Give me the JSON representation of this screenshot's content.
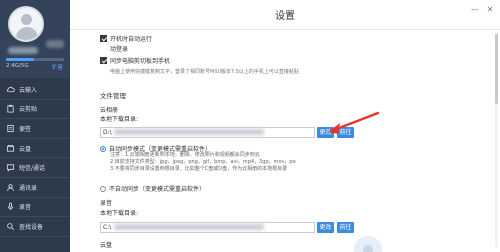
{
  "sidebar": {
    "storage_text": "2.4G/5G",
    "storage_link": "扩容",
    "storage_fraction": 0.48,
    "items": [
      {
        "label": "云输入",
        "icon": "cloud-input-icon"
      },
      {
        "label": "云剪贴",
        "icon": "clipboard-icon"
      },
      {
        "label": "便签",
        "icon": "note-icon"
      },
      {
        "label": "云盘",
        "icon": "cloud-drive-icon"
      },
      {
        "label": "短信/通话",
        "icon": "message-icon"
      },
      {
        "label": "通讯录",
        "icon": "contacts-icon"
      },
      {
        "label": "录音",
        "icon": "microphone-icon"
      },
      {
        "label": "查找设备",
        "icon": "find-device-icon"
      }
    ]
  },
  "header": {
    "title": "设置",
    "minimize": "—",
    "close": "✕"
  },
  "settings": {
    "autostart": "开机时自动运行",
    "autologin": "动登录",
    "sync_clipboard": "同步电脑剪切板到手机",
    "sync_hint": "电脑上使用快捷键复制文字，登录了相同账号MIUI版本7.5以上的手机上可以直接粘贴"
  },
  "file_management": {
    "section_title": "文件管理",
    "cloud_album": {
      "title": "云相册",
      "download_label": "本地下载目录:",
      "path_value": "D:\\",
      "change_btn": "更改",
      "open_btn": "前往"
    },
    "auto_sync": {
      "label": "自动同步模式（变更模式需重启软件）",
      "note1": "注意：1.云端相册更新到本地，删除、修改照片和视频都会同步到云",
      "note2": "2.目前支持文件类型：jpg，jpeg，png，gif，bmp，avi，mp4，3gp，mov，pe",
      "note3": "3.不要将同步目录设置到根目录、比如整个C盘或D盘，作为云相册的本地根目录"
    },
    "no_sync": {
      "label": "不自动同步（变更模式需重启软件）"
    },
    "recording": {
      "title": "录音",
      "download_label": "本地下载目录:",
      "path_value": "C:\\",
      "change_btn": "更改",
      "open_btn": "前往"
    },
    "cloud_drive": {
      "title": "云盘"
    }
  },
  "colors": {
    "sidebar_bg": "#2d3a4b",
    "accent": "#3d8be0",
    "arrow": "#e8342a"
  }
}
